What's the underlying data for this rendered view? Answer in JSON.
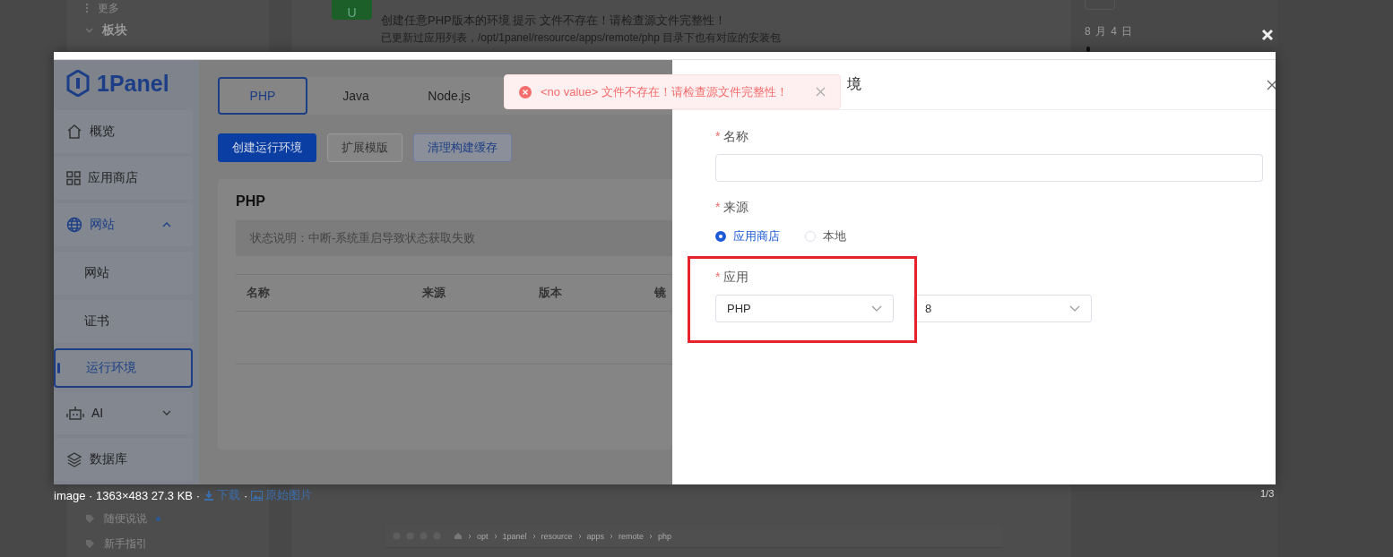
{
  "background_page": {
    "avatar_letter": "U",
    "sidebar_items": [
      {
        "label": "更多",
        "kind": "more"
      },
      {
        "label": "板块",
        "kind": "section"
      },
      {
        "label": "随便说说",
        "kind": "tag",
        "unread": true
      },
      {
        "label": "新手指引",
        "kind": "tag",
        "unread": false
      }
    ],
    "post_lines": [
      "创建任意PHP版本的环境 提示 文件不存在！请检查源文件完整性！",
      "已更新过应用列表，/opt/1panel/resource/apps/remote/php 目录下也有对应的安装包"
    ],
    "date": "8 月 4 日",
    "breadcrumb": [
      "opt",
      "1panel",
      "resource",
      "apps",
      "remote",
      "php"
    ]
  },
  "lightbox": {
    "caption": "image · 1363×483 27.3 KB ·",
    "download_link": "下载",
    "separator": "·",
    "original_link": "原始图片",
    "counter": "1/3"
  },
  "screenshot": {
    "logo": "1Panel",
    "nav": [
      {
        "label": "概览",
        "kind": "item",
        "selected": false
      },
      {
        "label": "应用商店",
        "kind": "item",
        "selected": false
      },
      {
        "label": "网站",
        "kind": "group",
        "expanded": true,
        "children": [
          {
            "label": "网站",
            "selected": false
          },
          {
            "label": "证书",
            "selected": false
          },
          {
            "label": "运行环境",
            "selected": true
          }
        ]
      },
      {
        "label": "AI",
        "kind": "group",
        "expanded": false
      },
      {
        "label": "数据库",
        "kind": "item",
        "selected": false
      }
    ],
    "tabs": [
      {
        "label": "PHP",
        "selected": true
      },
      {
        "label": "Java",
        "selected": false
      },
      {
        "label": "Node.js",
        "selected": false
      }
    ],
    "buttons": [
      {
        "label": "创建运行环境",
        "kind": "primary"
      },
      {
        "label": "扩展模版",
        "kind": "default"
      },
      {
        "label": "清理构建缓存",
        "kind": "plain"
      }
    ],
    "card": {
      "title": "PHP",
      "notice": "状态说明：中断-系统重启导致状态获取失败",
      "columns": [
        "名称",
        "来源",
        "版本",
        "镜"
      ]
    },
    "toast": {
      "message": "<no value> 文件不存在！请检查源文件完整性！"
    },
    "drawer": {
      "title": "境",
      "required_mark": "*",
      "fields": [
        {
          "label": "名称",
          "required": true,
          "kind": "text"
        },
        {
          "label": "来源",
          "required": true,
          "kind": "radio",
          "options": [
            {
              "label": "应用商店",
              "selected": true
            },
            {
              "label": "本地",
              "selected": false
            }
          ]
        },
        {
          "label": "应用",
          "required": true,
          "kind": "selects",
          "highlighted": true,
          "selects": [
            "PHP",
            "8"
          ]
        }
      ]
    }
  }
}
